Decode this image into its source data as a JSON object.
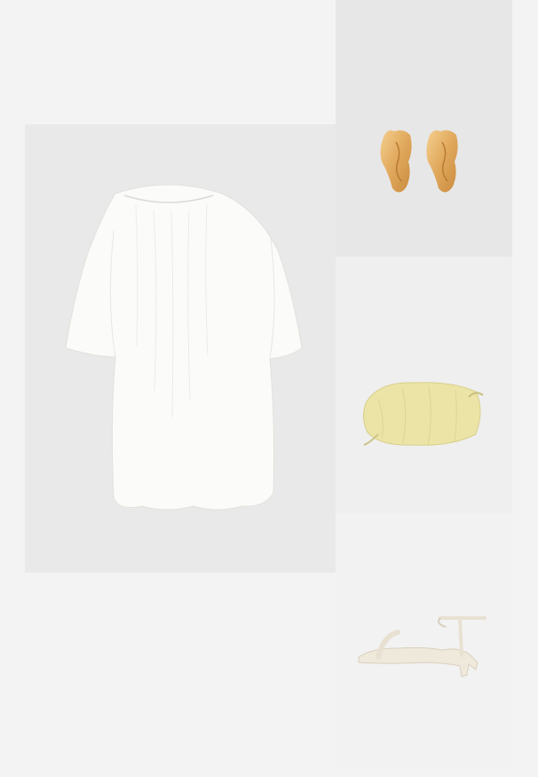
{
  "outfit": {
    "items": [
      {
        "id": "dress",
        "kind": "white-dress",
        "color": "#fbfbf9"
      },
      {
        "id": "earrings",
        "kind": "gold-earrings",
        "color": "#e0a85c"
      },
      {
        "id": "bag",
        "kind": "clutch-bag",
        "color": "#ece4a6"
      },
      {
        "id": "sandal",
        "kind": "heeled-sandal",
        "color": "#efe9dc"
      }
    ]
  },
  "colors": {
    "page_background": "#f3f3f3",
    "dress_panel": "#e9e9e9",
    "earrings_panel": "#e7e7e7",
    "bag_panel": "#efefef",
    "sandal_panel": "#f2f2f2"
  }
}
